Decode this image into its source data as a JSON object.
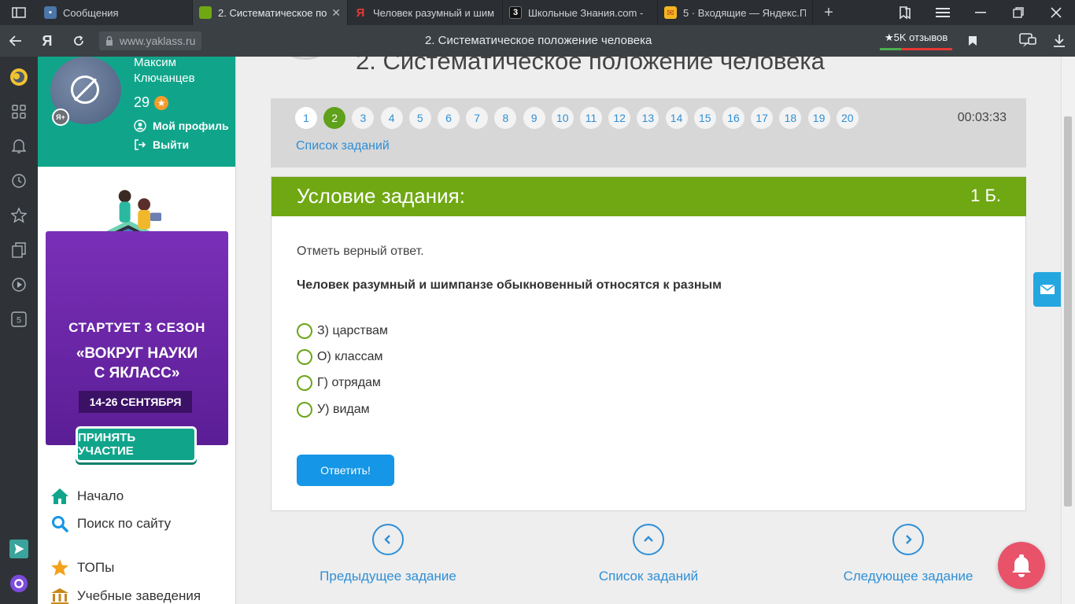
{
  "browser": {
    "tabs": [
      {
        "title": "Сообщения",
        "icon": "vk-messages-icon",
        "color": "#4a76a8",
        "active": false
      },
      {
        "title": "2. Систематическое по",
        "icon": "yaklass-book-icon",
        "color": "#6fa813",
        "active": true
      },
      {
        "title": "Человек разумный и шим",
        "icon": "yandex-icon",
        "color": "#e53935",
        "active": false
      },
      {
        "title": "Школьные Знания.com - ",
        "icon": "znanija-icon",
        "color": "#111111",
        "active": false
      },
      {
        "title": "5 · Входящие — Яндекс.П",
        "icon": "yandex-mail-icon",
        "color": "#f3b61f",
        "active": false
      }
    ],
    "url": "www.yaklass.ru",
    "page_title": "2. Систематическое положение человека",
    "reviews": "★5K отзывов",
    "yandex_logo": "Я"
  },
  "profile": {
    "name": "Максим Ключанцев",
    "points": "29",
    "my_profile": "Мой профиль",
    "logout": "Выйти",
    "ya_badge": "Я+"
  },
  "promo": {
    "line1": "СТАРТУЕТ  3 СЕЗОН",
    "line2": "«ВОКРУГ НАУКИ",
    "line3": "С ЯКЛАСС»",
    "dates": "14-26 СЕНТЯБРЯ",
    "button": "ПРИНЯТЬ УЧАСТИЕ"
  },
  "menu": {
    "home": "Начало",
    "search": "Поиск по сайту",
    "tops": "ТОПы",
    "schools": "Учебные заведения"
  },
  "page": {
    "heading": "2. Систематическое положение человека",
    "timer": "00:03:33",
    "task_list_link": "Список заданий",
    "question_numbers": [
      "1",
      "2",
      "3",
      "4",
      "5",
      "6",
      "7",
      "8",
      "9",
      "10",
      "11",
      "12",
      "13",
      "14",
      "15",
      "16",
      "17",
      "18",
      "19",
      "20"
    ],
    "current_question": "2"
  },
  "task": {
    "header": "Условие задания:",
    "points": "1 Б.",
    "instruction": "Отметь верный ответ.",
    "question": "Человек разумный и шимпанзе обыкновенный относятся к разным",
    "options": [
      "З) царствам",
      "О) классам",
      "Г) отрядам",
      "У) видам"
    ],
    "answer_button": "Ответить!"
  },
  "bottom_nav": {
    "prev": "Предыдущее задание",
    "list": "Список заданий",
    "next": "Следующее задание"
  },
  "colors": {
    "brand_teal": "#10a58b",
    "task_green": "#6fa813",
    "link_blue": "#2f8fd6",
    "button_blue": "#1596e6"
  }
}
